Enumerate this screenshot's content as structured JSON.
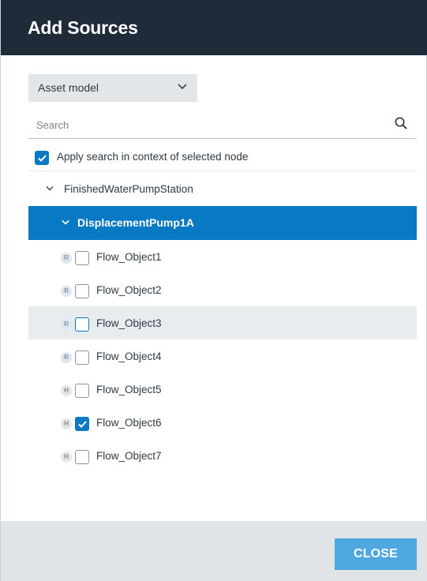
{
  "dialog": {
    "title": "Add Sources"
  },
  "selector": {
    "label": "Asset model",
    "icon": "chevron-down-icon"
  },
  "search": {
    "placeholder": "Search",
    "value": "",
    "icon": "search-icon"
  },
  "apply_context": {
    "label": "Apply search in context of selected node",
    "checked": true
  },
  "tree": {
    "root": {
      "label": "FinishedWaterPumpStation",
      "expanded": true
    },
    "selected_node": {
      "label": "DisplacementPump1A",
      "expanded": true
    },
    "items": [
      {
        "label": "Flow_Object1",
        "badge": "R",
        "checked": false
      },
      {
        "label": "Flow_Object2",
        "badge": "R",
        "checked": false
      },
      {
        "label": "Flow_Object3",
        "badge": "R",
        "checked": false
      },
      {
        "label": "Flow_Object4",
        "badge": "R",
        "checked": false
      },
      {
        "label": "Flow_Object5",
        "badge": "H",
        "checked": false
      },
      {
        "label": "Flow_Object6",
        "badge": "H",
        "checked": true
      },
      {
        "label": "Flow_Object7",
        "badge": "H",
        "checked": false
      }
    ]
  },
  "footer": {
    "close_label": "CLOSE"
  },
  "colors": {
    "header_bg": "#1f2b38",
    "accent": "#0a79c4",
    "button": "#4fa8e0",
    "footer_bg": "#e1e4e7"
  }
}
